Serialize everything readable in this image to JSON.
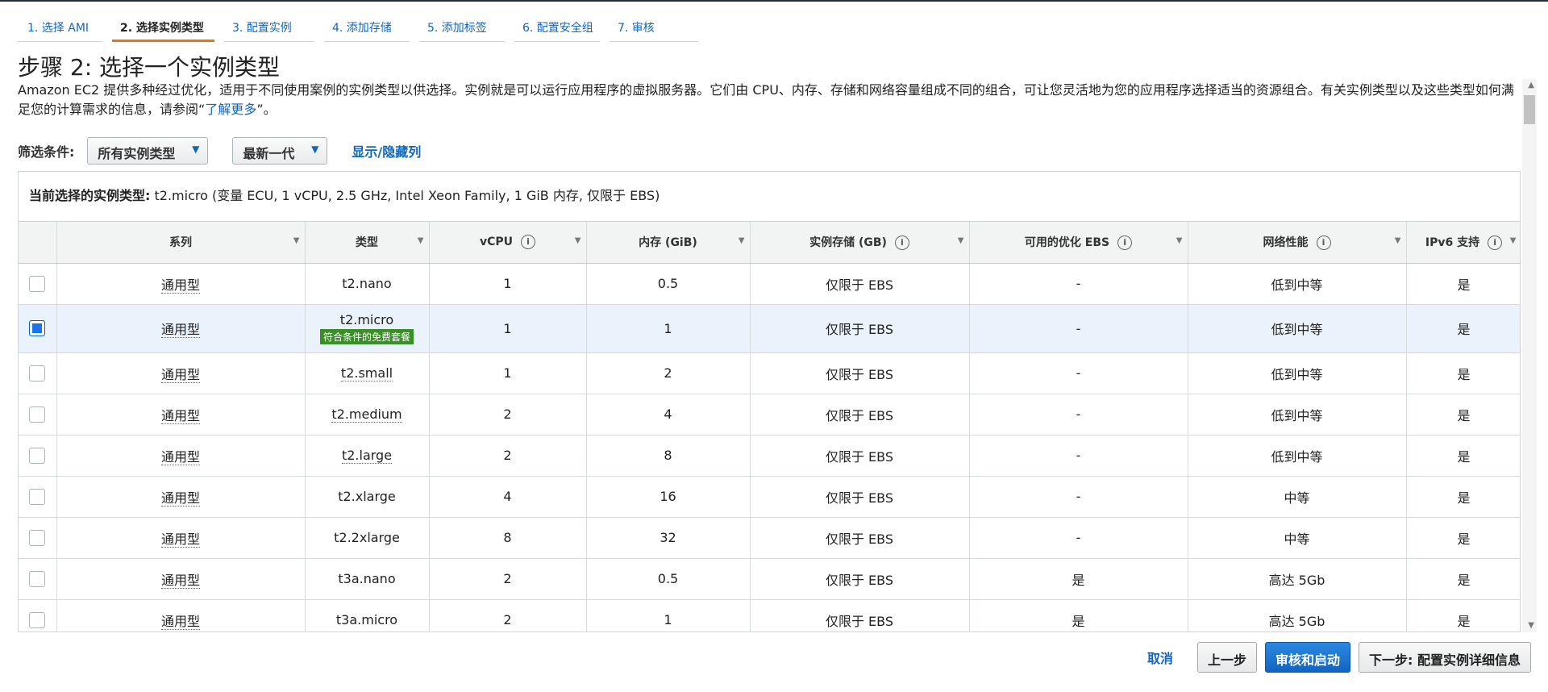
{
  "wizard": {
    "tabs": [
      {
        "label": "1. 选择 AMI",
        "active": false
      },
      {
        "label": "2. 选择实例类型",
        "active": true
      },
      {
        "label": "3. 配置实例",
        "active": false
      },
      {
        "label": "4. 添加存储",
        "active": false
      },
      {
        "label": "5. 添加标签",
        "active": false
      },
      {
        "label": "6. 配置安全组",
        "active": false
      },
      {
        "label": "7. 审核",
        "active": false
      }
    ]
  },
  "page": {
    "title": "步骤 2: 选择一个实例类型",
    "description_before": "Amazon EC2 提供多种经过优化，适用于不同使用案例的实例类型以供选择。实例就是可以运行应用程序的虚拟服务器。它们由 CPU、内存、存储和网络容量组成不同的组合，可让您灵活地为您的应用程序选择适当的资源组合。有关实例类型以及这些类型如何满足您的计算需求的信息，请参阅“",
    "description_link": "了解更多",
    "description_after": "”。"
  },
  "filter": {
    "label": "筛选条件:",
    "type_select": "所有实例类型",
    "generation_select": "最新一代",
    "toggle_columns": "显示/隐藏列"
  },
  "current_selection": {
    "label": "当前选择的实例类型:",
    "value": "t2.micro (变量 ECU, 1 vCPU, 2.5 GHz, Intel Xeon Family, 1 GiB 内存, 仅限于 EBS)"
  },
  "table": {
    "columns": [
      "系列",
      "类型",
      "vCPU",
      "内存 (GiB)",
      "实例存储 (GB)",
      "可用的优化 EBS",
      "网络性能",
      "IPv6 支持"
    ],
    "free_tier_badge": "符合条件的免费套餐",
    "rows": [
      {
        "family": "通用型",
        "type": "t2.nano",
        "vcpu": "1",
        "memory": "0.5",
        "storage": "仅限于 EBS",
        "ebs": "-",
        "network": "低到中等",
        "ipv6": "是",
        "selected": false
      },
      {
        "family": "通用型",
        "type": "t2.micro",
        "vcpu": "1",
        "memory": "1",
        "storage": "仅限于 EBS",
        "ebs": "-",
        "network": "低到中等",
        "ipv6": "是",
        "selected": true,
        "free_tier": true
      },
      {
        "family": "通用型",
        "type": "t2.small",
        "vcpu": "1",
        "memory": "2",
        "storage": "仅限于 EBS",
        "ebs": "-",
        "network": "低到中等",
        "ipv6": "是",
        "selected": false
      },
      {
        "family": "通用型",
        "type": "t2.medium",
        "vcpu": "2",
        "memory": "4",
        "storage": "仅限于 EBS",
        "ebs": "-",
        "network": "低到中等",
        "ipv6": "是",
        "selected": false
      },
      {
        "family": "通用型",
        "type": "t2.large",
        "vcpu": "2",
        "memory": "8",
        "storage": "仅限于 EBS",
        "ebs": "-",
        "network": "低到中等",
        "ipv6": "是",
        "selected": false
      },
      {
        "family": "通用型",
        "type": "t2.xlarge",
        "vcpu": "4",
        "memory": "16",
        "storage": "仅限于 EBS",
        "ebs": "-",
        "network": "中等",
        "ipv6": "是",
        "selected": false
      },
      {
        "family": "通用型",
        "type": "t2.2xlarge",
        "vcpu": "8",
        "memory": "32",
        "storage": "仅限于 EBS",
        "ebs": "-",
        "network": "中等",
        "ipv6": "是",
        "selected": false
      },
      {
        "family": "通用型",
        "type": "t3a.nano",
        "vcpu": "2",
        "memory": "0.5",
        "storage": "仅限于 EBS",
        "ebs": "是",
        "network": "高达 5Gb",
        "ipv6": "是",
        "selected": false
      },
      {
        "family": "通用型",
        "type": "t3a.micro",
        "vcpu": "2",
        "memory": "1",
        "storage": "仅限于 EBS",
        "ebs": "是",
        "network": "高达 5Gb",
        "ipv6": "是",
        "selected": false
      }
    ]
  },
  "footer": {
    "cancel": "取消",
    "previous": "上一步",
    "review_launch": "审核和启动",
    "next": "下一步: 配置实例详细信息"
  },
  "colors": {
    "link": "#1166bb",
    "active_tab_underline": "#ec7211",
    "primary_button": "#1a6fcf",
    "free_tier_badge": "#3a8f28",
    "selected_row": "#eaf2fb"
  }
}
